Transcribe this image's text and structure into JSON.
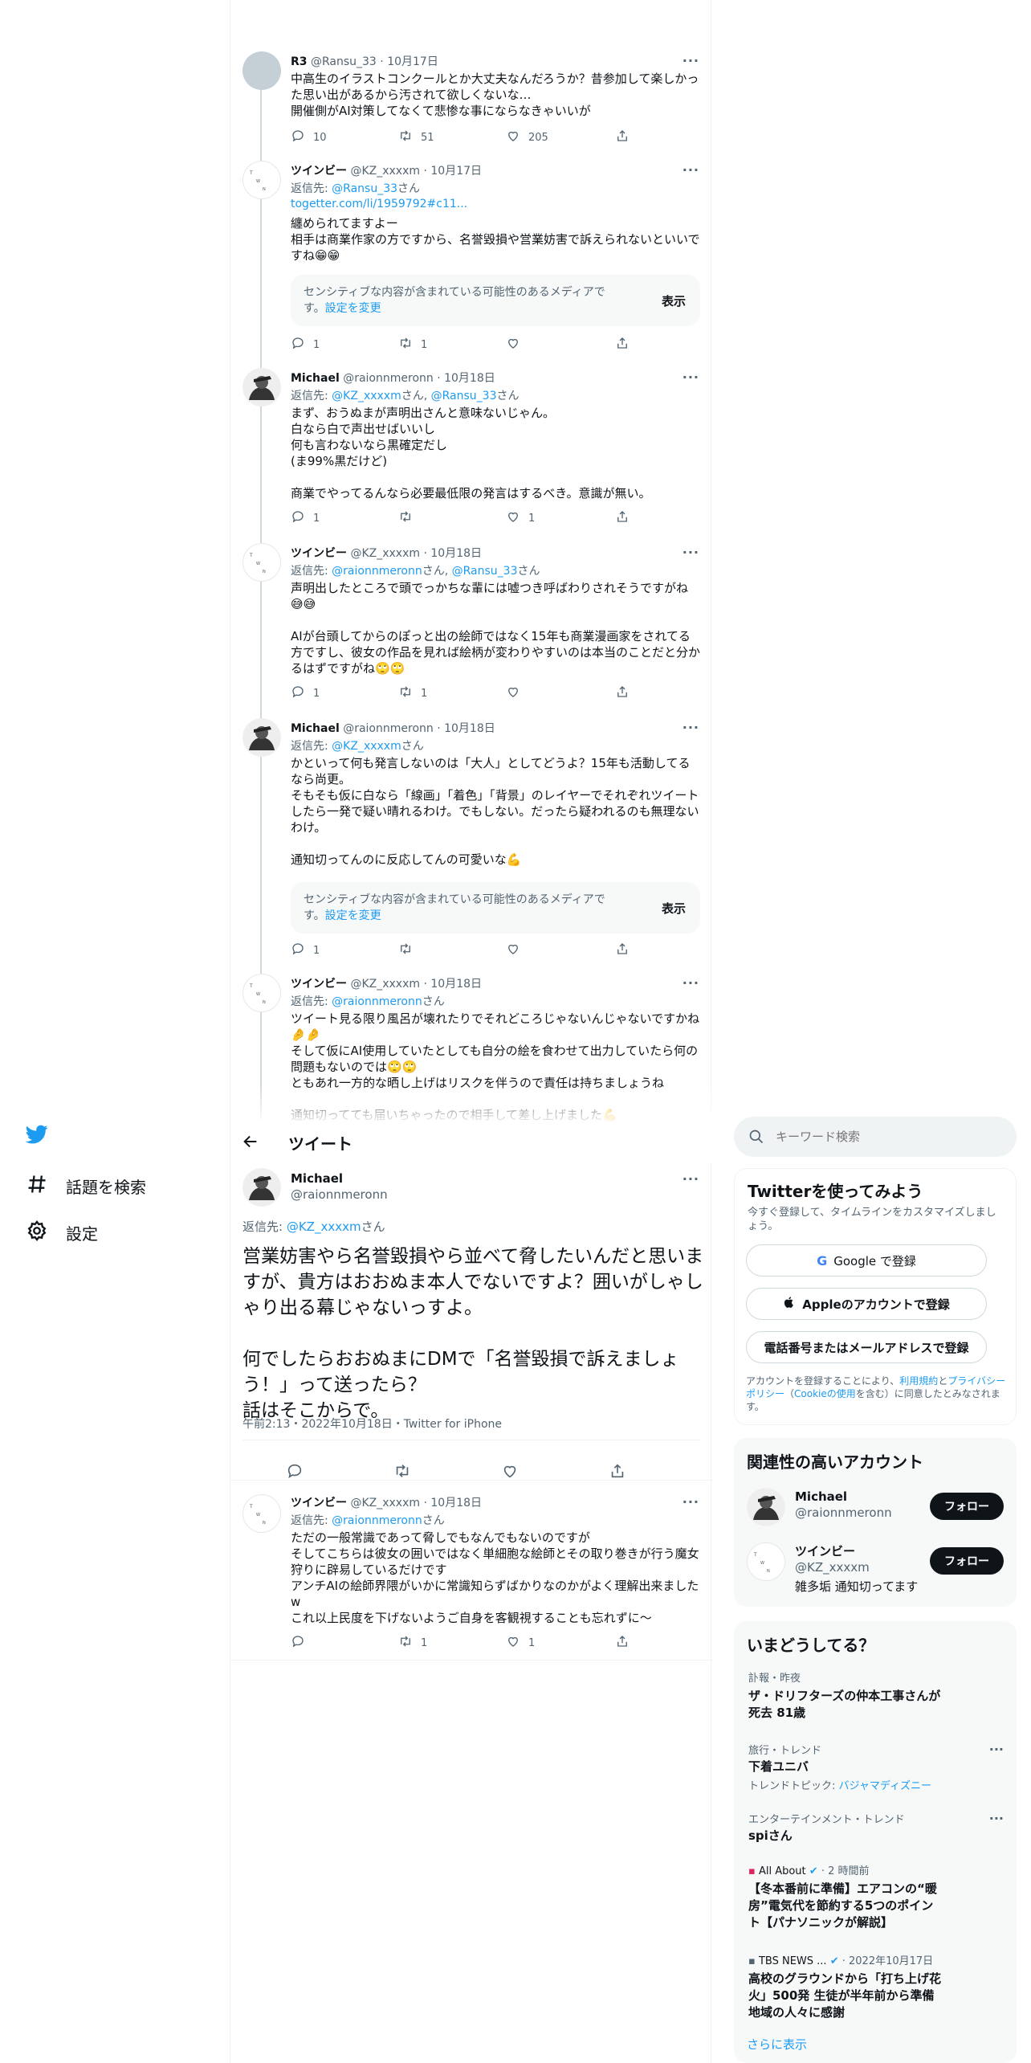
{
  "thread": [
    {
      "avatar": "gray",
      "name": "R3",
      "handle": "@Ransu_33",
      "date": "10月17日",
      "reply_prefix": "",
      "reply_to": [],
      "body": "中高生のイラストコンクールとか大丈夫なんだろうか？昔参加して楽しかった思い出があるから汚されて欲しくないな…\n開催側がAI対策してなくて悲惨な事にならなきゃいいが",
      "replies": "10",
      "retweets": "51",
      "likes": "205"
    },
    {
      "avatar": "twinbee",
      "name": "ツインビー",
      "handle": "@KZ_xxxxm",
      "date": "10月17日",
      "reply_prefix": "返信先: ",
      "reply_to": [
        "@Ransu_33"
      ],
      "reply_suffix": "さん",
      "link": "togetter.com/li/1959792#c11...",
      "body": "纏められてますよー\n相手は商業作家の方ですから、名誉毀損や営業妨害で訴えられないといいですね😁😁",
      "sensitive": "センシティブな内容が含まれている可能性のあるメディアです。",
      "sensitive_link": "設定を変更",
      "sensitive_btn": "表示",
      "replies": "1",
      "retweets": "1",
      "likes": ""
    },
    {
      "avatar": "michael",
      "name": "Michael",
      "handle": "@raionnmeronn",
      "date": "10月18日",
      "reply_prefix": "返信先: ",
      "reply_to": [
        "@KZ_xxxxm",
        "@Ransu_33"
      ],
      "body": "まず、おうぬまが声明出さんと意味ないじゃん。\n白なら白で声出せばいいし\n何も言わないなら黒確定だし\n(ま99%黒だけど)\n\n商業でやってるんなら必要最低限の発言はするべき。意識が無い。",
      "replies": "1",
      "retweets": "",
      "likes": "1"
    },
    {
      "avatar": "twinbee",
      "name": "ツインビー",
      "handle": "@KZ_xxxxm",
      "date": "10月18日",
      "reply_prefix": "返信先: ",
      "reply_to": [
        "@raionnmeronn",
        "@Ransu_33"
      ],
      "body": "声明出したところで頭でっかちな輩には嘘つき呼ばわりされそうですがね😅😅\n\nAIが台頭してからのぽっと出の絵師ではなく15年も商業漫画家をされてる方ですし、彼女の作品を見れば絵柄が変わりやすいのは本当のことだと分かるはずですがね🙄🙄",
      "replies": "1",
      "retweets": "1",
      "likes": ""
    },
    {
      "avatar": "michael",
      "name": "Michael",
      "handle": "@raionnmeronn",
      "date": "10月18日",
      "reply_prefix": "返信先: ",
      "reply_to": [
        "@KZ_xxxxm"
      ],
      "body": "かといって何も発言しないのは「大人」としてどうよ？15年も活動してるなら尚更。\nそもそも仮に白なら「線画」「着色」「背景」のレイヤーでそれぞれツイートしたら一発で疑い晴れるわけ。でもしない。だったら疑われるのも無理ないわけ。\n\n通知切ってんのに反応してんの可愛いな💪",
      "sensitive": "センシティブな内容が含まれている可能性のあるメディアです。",
      "sensitive_link": "設定を変更",
      "sensitive_btn": "表示",
      "replies": "1",
      "retweets": "",
      "likes": ""
    },
    {
      "avatar": "twinbee",
      "name": "ツインビー",
      "handle": "@KZ_xxxxm",
      "date": "10月18日",
      "reply_prefix": "返信先: ",
      "reply_to": [
        "@raionnmeronn"
      ],
      "body": "ツイート見る限り風呂が壊れたりでそれどころじゃないんじゃないですかね🤌🤌\nそして仮にAI使用していたとしても自分の絵を食わせて出力していたら何の問題もないのでは🙄🙄\nともあれ一方的な晒し上げはリスクを伴うので責任は持ちましょうね\n\n通知切ってても届いちゃったので相手して差し上げました💪"
    }
  ],
  "left_nav": {
    "explore": "話題を検索",
    "settings": "設定"
  },
  "header": {
    "title": "ツイート"
  },
  "main_tweet": {
    "name": "Michael",
    "handle": "@raionnmeronn",
    "reply_prefix": "返信先: ",
    "reply_to": "@KZ_xxxxm",
    "reply_suffix": "さん",
    "body": "営業妨害やら名誉毀損やら並べて脅したいんだと思いますが、貴方はおおぬま本人でないですよ？囲いがしゃしゃり出る幕じゃないっすよ。\n\n何でしたらおおぬまにDMで「名誉毀損で訴えましょう！」って送ったら？\n話はそこからで。",
    "meta": "午前2:13・2022年10月18日・Twitter for iPhone"
  },
  "reply_tweet": {
    "name": "ツインビー",
    "handle": "@KZ_xxxxm",
    "date": "10月18日",
    "reply_prefix": "返信先: ",
    "reply_to": "@raionnmeronn",
    "reply_suffix": "さん",
    "body": "ただの一般常識であって脅しでもなんでもないのですが\nそしてこちらは彼女の囲いではなく単細胞な絵師とその取り巻きが行う魔女狩りに辟易しているだけです\nアンチAIの絵師界隈がいかに常識知らずばかりなのかがよく理解出来ましたw\nこれ以上民度を下げないようご自身を客観視することも忘れずに〜",
    "replies": "",
    "retweets": "1",
    "likes": "1"
  },
  "search": {
    "placeholder": "キーワード検索"
  },
  "signup": {
    "title": "Twitterを使ってみよう",
    "desc": "今すぐ登録して、タイムラインをカスタマイズしましょう。",
    "google": "Google で登録",
    "apple": "Appleのアカウントで登録",
    "phone": "電話番号またはメールアドレスで登録",
    "legal_pre": "アカウントを登録することにより、",
    "legal_terms": "利用規約",
    "legal_and": "と",
    "legal_privacy": "プライバシーポリシー",
    "legal_cookie_open": "（",
    "legal_cookie": "Cookieの使用",
    "legal_post": "を含む）に同意したとみなされます。"
  },
  "related": {
    "title": "関連性の高いアカウント",
    "accounts": [
      {
        "name": "Michael",
        "handle": "@raionnmeronn",
        "bio": "",
        "follow": "フォロー"
      },
      {
        "name": "ツインビー",
        "handle": "@KZ_xxxxm",
        "bio": "雑多垢 通知切ってます",
        "follow": "フォロー"
      }
    ]
  },
  "trends": {
    "title": "いまどうしてる？",
    "items": [
      {
        "category": "訃報・昨夜",
        "name": "ザ・ドリフターズの仲本工事さんが死去 81歳",
        "sub": ""
      },
      {
        "category": "旅行・トレンド",
        "name": "下着ユニバ",
        "sub_pre": "トレンドトピック: ",
        "sub_link": "バジャマディズニー"
      },
      {
        "category": "エンターテインメント・トレンド",
        "name": "spiさん",
        "sub": ""
      },
      {
        "category": "All About",
        "time": "2 時間前",
        "name": "【冬本番前に準備】エアコンの“暖房”電気代を節約する5つのポイント【パナソニックが解説】"
      },
      {
        "category": "TBS NEWS ...",
        "time": "2022年10月17日",
        "name": "高校のグラウンドから「打ち上げ花火」500発 生徒が半年前から準備 地域の人々に感謝"
      }
    ],
    "more": "さらに表示"
  },
  "colors": {
    "accent": "#1d9bf0",
    "text": "#0f1419",
    "secondary": "#536471",
    "border": "#eff3f4"
  }
}
